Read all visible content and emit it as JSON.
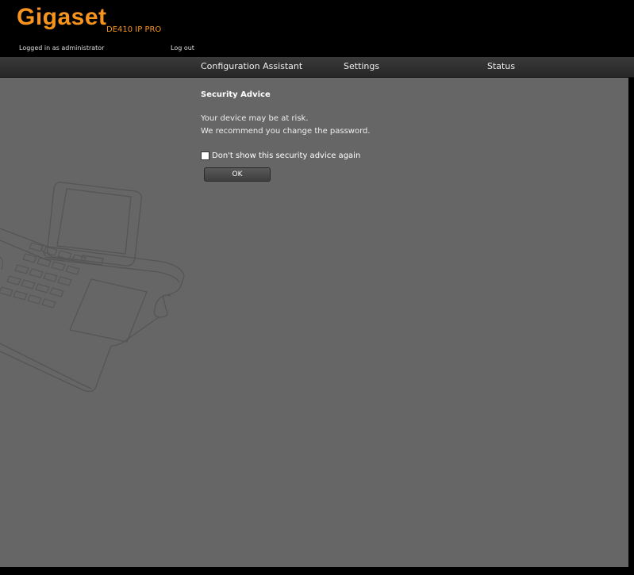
{
  "header": {
    "logo": "Gigaset",
    "model": "DE410 IP PRO",
    "logged_in": "Logged in as administrator",
    "logout": "Log out"
  },
  "nav": {
    "items": [
      {
        "label": "Configuration Assistant"
      },
      {
        "label": "Settings"
      },
      {
        "label": "Status"
      }
    ]
  },
  "dialog": {
    "title": "Security Advice",
    "line1": "Your device may be at risk.",
    "line2": "We recommend you change the password.",
    "checkbox_label": "Don't show this security advice again",
    "checkbox_checked": false,
    "ok_label": "OK"
  },
  "colors": {
    "brand": "#f7941d",
    "content_bg": "#666666"
  }
}
